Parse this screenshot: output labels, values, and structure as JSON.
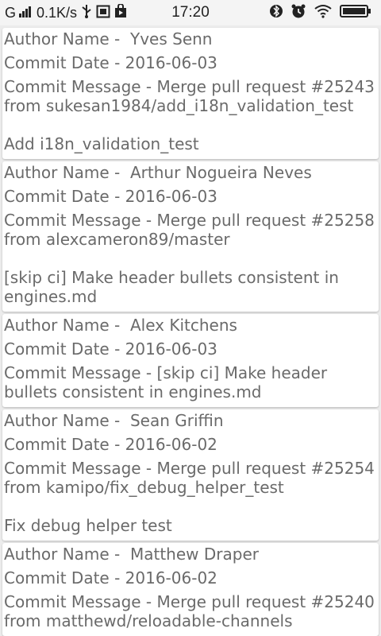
{
  "status_bar": {
    "carrier": "G",
    "net_speed": "0.1K/s",
    "time": "17:20"
  },
  "commits": [
    {
      "author_label": "Author Name -  Yves Senn",
      "date_label": "Commit Date - 2016-06-03",
      "message_label": "Commit Message - Merge pull request #25243 from sukesan1984/add_i18n_validation_test\n\nAdd i18n_validation_test"
    },
    {
      "author_label": "Author Name -  Arthur Nogueira Neves",
      "date_label": "Commit Date - 2016-06-03",
      "message_label": "Commit Message - Merge pull request #25258 from alexcameron89/master\n\n[skip ci] Make header bullets consistent in engines.md"
    },
    {
      "author_label": "Author Name -  Alex Kitchens",
      "date_label": "Commit Date - 2016-06-03",
      "message_label": "Commit Message - [skip ci] Make header bullets consistent in engines.md"
    },
    {
      "author_label": "Author Name -  Sean Griffin",
      "date_label": "Commit Date - 2016-06-02",
      "message_label": "Commit Message - Merge pull request #25254 from kamipo/fix_debug_helper_test\n\nFix debug helper test"
    },
    {
      "author_label": "Author Name -  Matthew Draper",
      "date_label": "Commit Date - 2016-06-02",
      "message_label": "Commit Message - Merge pull request #25240 from matthewd/reloadable-channels"
    }
  ]
}
